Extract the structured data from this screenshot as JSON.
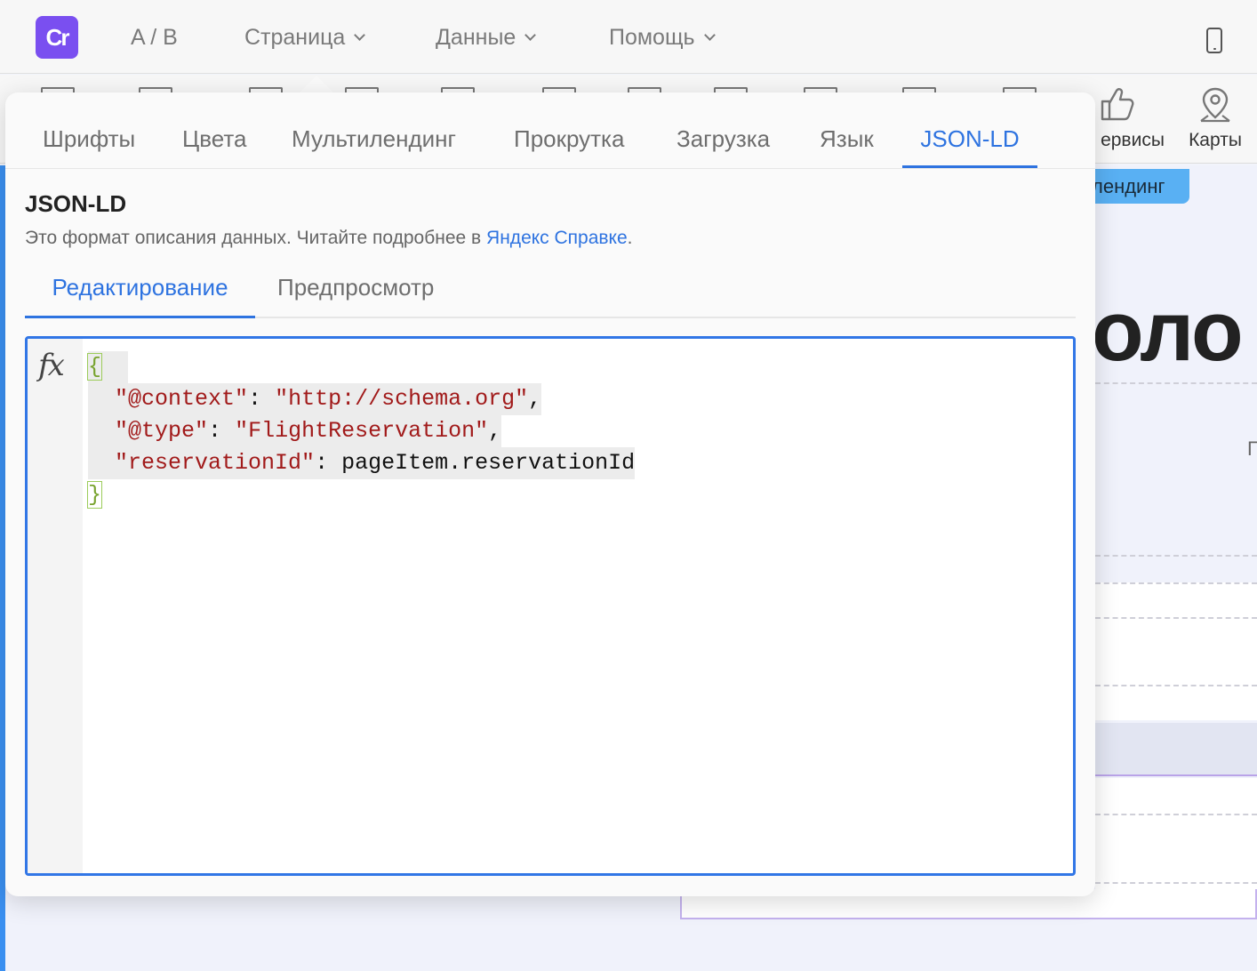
{
  "topbar": {
    "logo_text": "Cr",
    "nav": [
      {
        "label": "A / B",
        "has_dropdown": false
      },
      {
        "label": "Страница",
        "has_dropdown": true
      },
      {
        "label": "Данные",
        "has_dropdown": true
      },
      {
        "label": "Помощь",
        "has_dropdown": true
      }
    ],
    "device_icon": "mobile-phone-icon"
  },
  "toolbar": {
    "services_label": "ервисы",
    "maps_label": "Карты",
    "services_icon": "thumbs-up-icon",
    "maps_icon": "map-pin-icon"
  },
  "canvas": {
    "tab_label": "лендинг",
    "heading_fragment": "оло",
    "stray_char": "Г"
  },
  "popover": {
    "tabs": [
      {
        "label": "Шрифты",
        "active": false
      },
      {
        "label": "Цвета",
        "active": false
      },
      {
        "label": "Мультилендинг",
        "active": false
      },
      {
        "label": "Прокрутка",
        "active": false
      },
      {
        "label": "Загрузка",
        "active": false
      },
      {
        "label": "Язык",
        "active": false
      },
      {
        "label": "JSON-LD",
        "active": true
      }
    ],
    "title": "JSON-LD",
    "description_prefix": "Это формат описания данных. Читайте подробнее в ",
    "description_link": "Яндекс Справке",
    "description_suffix": ".",
    "subtabs": [
      {
        "label": "Редактирование",
        "active": true
      },
      {
        "label": "Предпросмотр",
        "active": false
      }
    ],
    "editor": {
      "gutter_icon": "function-fx-icon",
      "gutter_text": "fx",
      "open_brace": "{",
      "close_brace": "}",
      "lines": [
        {
          "key": "\"@context\"",
          "sep": ": ",
          "value": "\"http://schema.org\"",
          "value_is_string": true,
          "trail": ","
        },
        {
          "key": "\"@type\"",
          "sep": ": ",
          "value": "\"FlightReservation\"",
          "value_is_string": true,
          "trail": ","
        },
        {
          "key": "\"reservationId\"",
          "sep": ": ",
          "value": "pageItem.reservationId",
          "value_is_string": false,
          "trail": ""
        }
      ]
    }
  },
  "colors": {
    "accent": "#2e73e0",
    "logo_bg": "#7a4ff0",
    "string": "#a11a1a",
    "brace": "#78a32e"
  }
}
